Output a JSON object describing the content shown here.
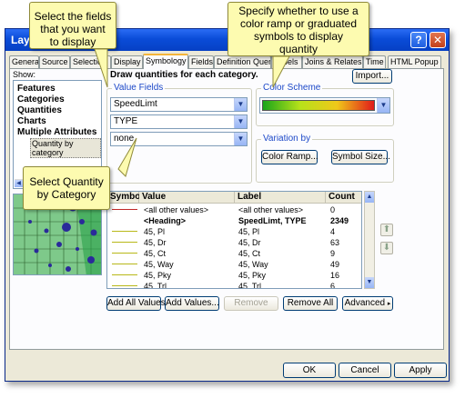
{
  "window": {
    "title": "Layer Properties"
  },
  "titlebar": {
    "help_glyph": "?",
    "close_glyph": "✕"
  },
  "tabs": [
    {
      "label": "General"
    },
    {
      "label": "Source"
    },
    {
      "label": "Selection"
    },
    {
      "label": "Display"
    },
    {
      "label": "Symbology"
    },
    {
      "label": "Fields"
    },
    {
      "label": "Definition Query"
    },
    {
      "label": "Labels"
    },
    {
      "label": "Joins & Relates"
    },
    {
      "label": "Time"
    },
    {
      "label": "HTML Popup"
    }
  ],
  "show": {
    "label": "Show:",
    "items": [
      "Features",
      "Categories",
      "Quantities",
      "Charts",
      "Multiple Attributes"
    ],
    "sub_item": "Quantity by category"
  },
  "main": {
    "heading": "Draw quantities for each category.",
    "import_button": "Import...",
    "value_fields_title": "Value Fields",
    "value_fields": [
      "SpeedLimt",
      "TYPE",
      "none"
    ],
    "color_scheme_title": "Color Scheme",
    "variation_title": "Variation by",
    "color_ramp_button": "Color Ramp...",
    "symbol_size_button": "Symbol Size..."
  },
  "grid": {
    "columns": [
      "Symbol",
      "Value",
      "Label",
      "Count"
    ],
    "rows": [
      {
        "value": "<all other values>",
        "label": "<all other values>",
        "count": "0",
        "bold": false
      },
      {
        "value": "<Heading>",
        "label": "SpeedLimt, TYPE",
        "count": "2349",
        "bold": true
      },
      {
        "value": "45, Pl",
        "label": "45, Pl",
        "count": "4",
        "bold": false
      },
      {
        "value": "45, Dr",
        "label": "45, Dr",
        "count": "63",
        "bold": false
      },
      {
        "value": "45, Ct",
        "label": "45, Ct",
        "count": "9",
        "bold": false
      },
      {
        "value": "45, Way",
        "label": "45, Way",
        "count": "49",
        "bold": false
      },
      {
        "value": "45, Pky",
        "label": "45, Pky",
        "count": "16",
        "bold": false
      },
      {
        "value": "45, Trl",
        "label": "45, Trl",
        "count": "6",
        "bold": false
      }
    ]
  },
  "actions": {
    "add_all_values": "Add All Values",
    "add_values": "Add Values...",
    "remove": "Remove",
    "remove_all": "Remove All",
    "advanced": "Advanced"
  },
  "footer": {
    "ok": "OK",
    "cancel": "Cancel",
    "apply": "Apply"
  },
  "callouts": {
    "fields_line1": "Select the fields",
    "fields_line2": "that you want",
    "fields_line3": "to display",
    "color_line1": "Specify whether to use a",
    "color_line2": "color ramp or graduated",
    "color_line3": "symbols to display",
    "color_line4": "quantity",
    "category_line1": "Select Quantity",
    "category_line2": "by Category"
  },
  "colors": {
    "ramp": [
      "#1aa51a",
      "#b7e21a",
      "#f0c81a",
      "#e01a1a"
    ],
    "symbol_line": "#b8b818",
    "callout_bg": "#fdfbb0"
  }
}
